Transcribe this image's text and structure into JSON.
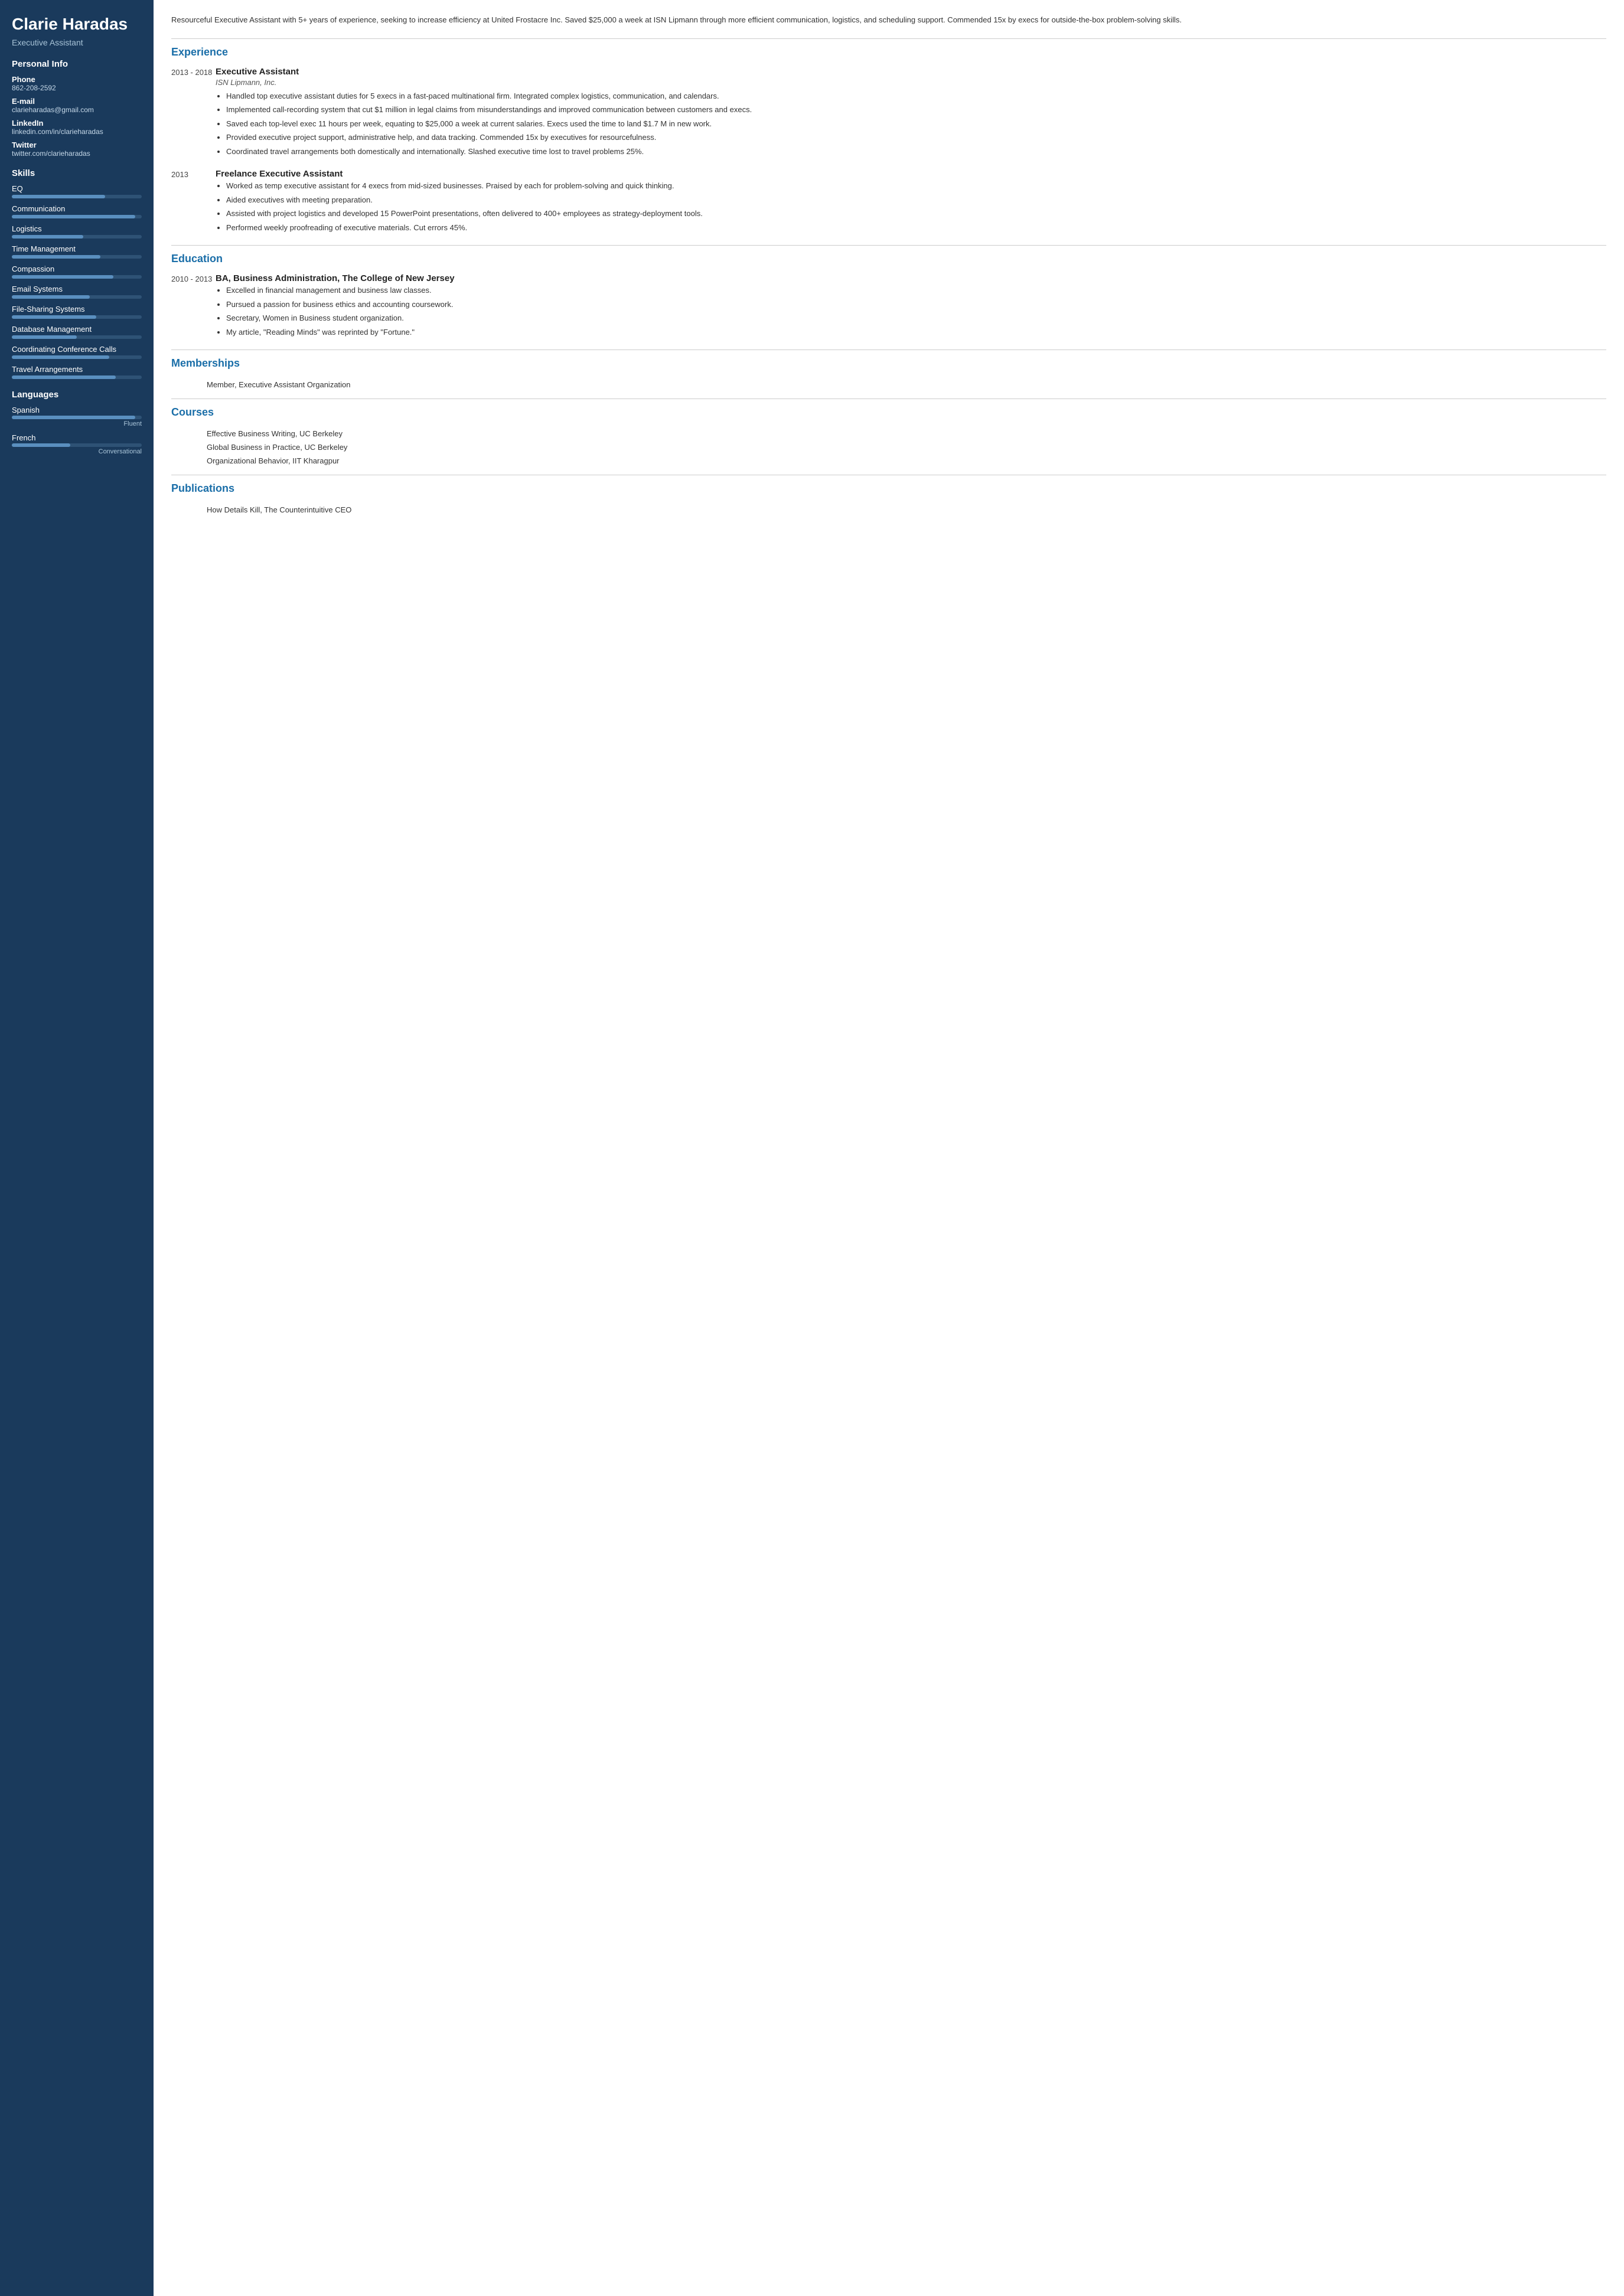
{
  "sidebar": {
    "name": "Clarie Haradas",
    "job_title": "Executive Assistant",
    "personal_info": {
      "title": "Personal Info",
      "phone_label": "Phone",
      "phone": "862-208-2592",
      "email_label": "E-mail",
      "email": "clarieharadas@gmail.com",
      "linkedin_label": "LinkedIn",
      "linkedin": "linkedin.com/in/clarieharadas",
      "twitter_label": "Twitter",
      "twitter": "twitter.com/clarieharadas"
    },
    "skills_title": "Skills",
    "skills": [
      {
        "name": "EQ",
        "pct": 72
      },
      {
        "name": "Communication",
        "pct": 95
      },
      {
        "name": "Logistics",
        "pct": 55
      },
      {
        "name": "Time Management",
        "pct": 68
      },
      {
        "name": "Compassion",
        "pct": 78
      },
      {
        "name": "Email Systems",
        "pct": 60
      },
      {
        "name": "File-Sharing Systems",
        "pct": 65
      },
      {
        "name": "Database Management",
        "pct": 50
      },
      {
        "name": "Coordinating Conference Calls",
        "pct": 75
      },
      {
        "name": "Travel Arrangements",
        "pct": 80
      }
    ],
    "languages_title": "Languages",
    "languages": [
      {
        "name": "Spanish",
        "pct": 95,
        "level": "Fluent"
      },
      {
        "name": "French",
        "pct": 45,
        "level": "Conversational"
      }
    ]
  },
  "main": {
    "summary": "Resourceful Executive Assistant with 5+ years of experience, seeking to increase efficiency at United Frostacre Inc. Saved $25,000 a week at ISN Lipmann through more efficient communication, logistics, and scheduling support. Commended 15x by execs for outside-the-box problem-solving skills.",
    "experience_title": "Experience",
    "experience": [
      {
        "date": "2013 - 2018",
        "title": "Executive Assistant",
        "company": "ISN Lipmann, Inc.",
        "bullets": [
          "Handled top executive assistant duties for 5 execs in a fast-paced multinational firm. Integrated complex logistics, communication, and calendars.",
          "Implemented call-recording system that cut $1 million in legal claims from misunderstandings and improved communication between customers and execs.",
          "Saved each top-level exec 11 hours per week, equating to $25,000 a week at current salaries. Execs used the time to land $1.7 M in new work.",
          "Provided executive project support, administrative help, and data tracking. Commended 15x by executives for resourcefulness.",
          "Coordinated travel arrangements both domestically and internationally. Slashed executive time lost to travel problems 25%."
        ]
      },
      {
        "date": "2013",
        "title": "Freelance Executive Assistant",
        "company": "",
        "bullets": [
          "Worked as temp executive assistant for 4 execs from mid-sized businesses. Praised by each for problem-solving and quick thinking.",
          "Aided executives with meeting preparation.",
          "Assisted with project logistics and developed 15 PowerPoint presentations, often delivered to 400+ employees as strategy-deployment tools.",
          "Performed weekly proofreading of executive materials. Cut errors 45%."
        ]
      }
    ],
    "education_title": "Education",
    "education": [
      {
        "date": "2010 - 2013",
        "title": "BA, Business Administration, The College of New Jersey",
        "company": "",
        "bullets": [
          "Excelled in financial management and business law classes.",
          "Pursued a passion for business ethics and accounting coursework.",
          "Secretary, Women in Business student organization.",
          "My article, \"Reading Minds\" was reprinted by \"Fortune.\""
        ]
      }
    ],
    "memberships_title": "Memberships",
    "memberships": [
      "Member, Executive Assistant Organization"
    ],
    "courses_title": "Courses",
    "courses": [
      "Effective Business Writing, UC Berkeley",
      "Global Business in Practice, UC Berkeley",
      "Organizational Behavior, IIT Kharagpur"
    ],
    "publications_title": "Publications",
    "publications": [
      "How Details Kill, The Counterintuitive CEO"
    ]
  }
}
